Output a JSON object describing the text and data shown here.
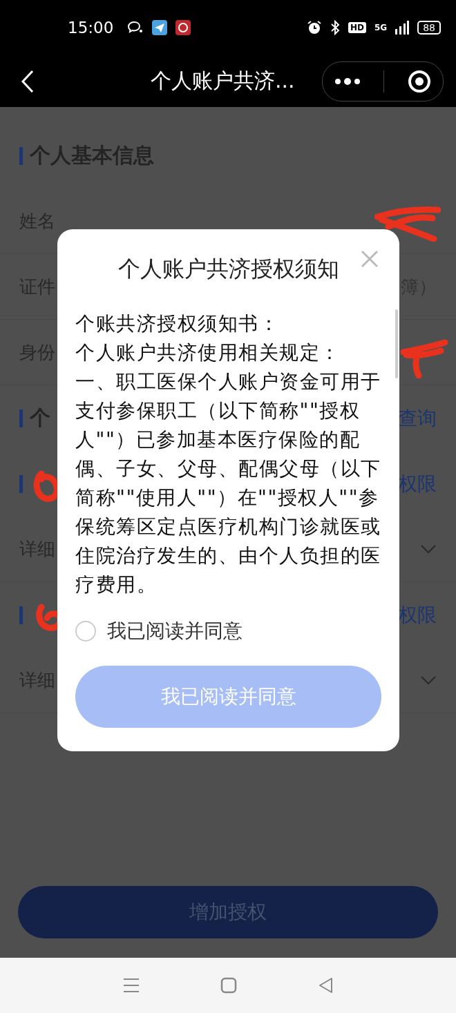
{
  "status_bar": {
    "time": "15:00",
    "hd": "HD",
    "network": "5G",
    "battery": "88"
  },
  "nav": {
    "title": "个人账户共济..."
  },
  "rows": [
    {
      "kind": "header",
      "title": "个人基本信息"
    },
    {
      "kind": "field",
      "label": "姓名"
    },
    {
      "kind": "field",
      "label": "证件",
      "value": "簿）"
    },
    {
      "kind": "field",
      "label": "身份"
    },
    {
      "kind": "header",
      "title": "个",
      "link": "查询"
    },
    {
      "kind": "header",
      "link": "权限"
    },
    {
      "kind": "select",
      "label": "详细"
    },
    {
      "kind": "header",
      "link": "权限"
    },
    {
      "kind": "select",
      "label": "详细"
    }
  ],
  "main_button": {
    "label": "增加授权"
  },
  "dialog": {
    "title": "个人账户共济授权须知",
    "paragraphs": [
      "个账共济授权须知书：",
      "个人账户共济使用相关规定：",
      "一、职工医保个人账户资金可用于支付参保职工（以下简称\"\"授权人\"\"）已参加基本医疗保险的配偶、子女、父母、配偶父母（以下简称\"\"使用人\"\"）在\"\"授权人\"\"参保统筹区定点医疗机构门诊就医或住院治疗发生的、由个人负担的医疗费用。"
    ],
    "agree": {
      "label": "我已阅读并同意",
      "checked": false
    },
    "confirm": {
      "label": "我已阅读并同意",
      "disabled": true
    }
  }
}
